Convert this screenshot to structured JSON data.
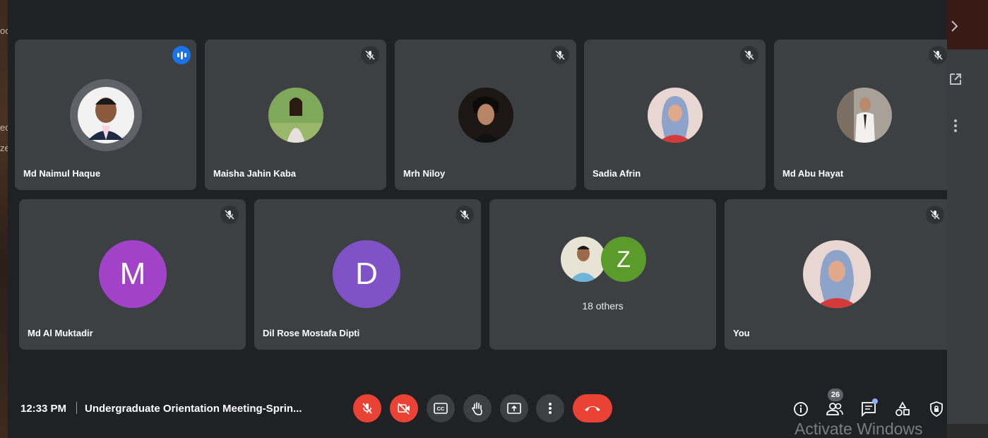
{
  "left_fragments": [
    "oc",
    "ec",
    "ze"
  ],
  "tiles_row1": [
    {
      "name": "Md Naimul Haque",
      "status": "speaking"
    },
    {
      "name": "Maisha Jahin Kaba",
      "status": "muted"
    },
    {
      "name": "Mrh Niloy",
      "status": "muted"
    },
    {
      "name": "Sadia Afrin",
      "status": "muted"
    },
    {
      "name": "Md Abu Hayat",
      "status": "muted"
    }
  ],
  "tiles_row2": [
    {
      "name": "Md Al Muktadir",
      "initial": "M",
      "avatar_color": "#a142c9",
      "status": "muted"
    },
    {
      "name": "Dil Rose Mostafa Dipti",
      "initial": "D",
      "avatar_color": "#7f53c7",
      "status": "muted"
    }
  ],
  "others_tile": {
    "initial": "Z",
    "avatar_color": "#5b9b2c",
    "label": "18 others"
  },
  "you_tile": {
    "name": "You",
    "status": "muted"
  },
  "bottom_bar": {
    "time": "12:33 PM",
    "meeting_title": "Undergraduate Orientation Meeting-Sprin...",
    "participant_count": "26",
    "controls": [
      "mic-off-icon",
      "camera-off-icon",
      "captions-icon",
      "raise-hand-icon",
      "present-icon",
      "more-icon",
      "end-call-icon"
    ],
    "right_icons": [
      "info-icon",
      "people-icon",
      "chat-icon",
      "activities-icon",
      "host-controls-icon"
    ]
  },
  "watermark": "Activate Windows",
  "colors": {
    "background": "#202124",
    "tile": "#3c4043",
    "red": "#ea4335",
    "speaking": "#1a73e8"
  }
}
